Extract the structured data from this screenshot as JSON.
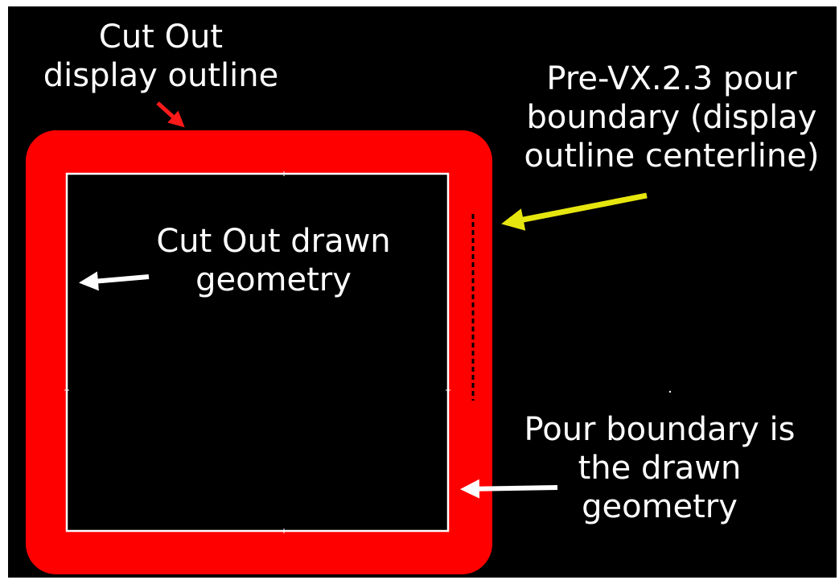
{
  "labels": {
    "cutout_display_outline": [
      "Cut Out",
      "display outline"
    ],
    "pre_vx_pour_boundary": [
      "Pre-VX.2.3 pour",
      "boundary (display",
      "outline centerline)"
    ],
    "cutout_drawn_geometry": [
      "Cut Out drawn",
      "geometry"
    ],
    "pour_boundary_drawn": [
      "Pour boundary is",
      "the drawn",
      "geometry"
    ]
  },
  "colors": {
    "background": "#000000",
    "display_outline": "#ff0000",
    "drawn_geometry": "#ffffff",
    "centerline": "#000000",
    "arrow_red": "#ff1a1a",
    "arrow_yellow": "#e6e60f",
    "arrow_white": "#ffffff",
    "text": "#ffffff"
  }
}
